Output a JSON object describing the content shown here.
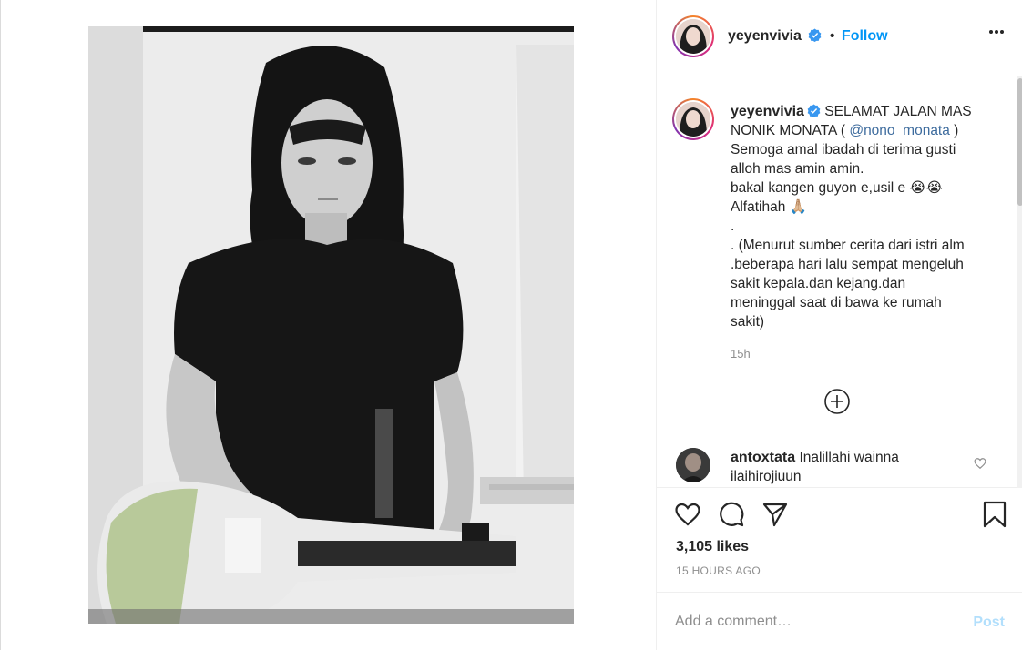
{
  "post": {
    "author": "yeyenvivia",
    "follow_label": "Follow",
    "separator": "•",
    "caption_lines": [
      "SELAMAT JALAN MAS",
      "NONIK MONATA ( ",
      "@nono_monata",
      " )",
      "Semoga amal ibadah di terima gusti",
      "alloh mas amin amin.",
      "bakal kangen guyon e,usil e 😭😭",
      "Alfatihah 🙏🏼",
      ".",
      ". (Menurut sumber cerita dari istri alm",
      ".beberapa hari lalu sempat mengeluh",
      "sakit kepala.dan kejang.dan",
      "meninggal saat di bawa ke rumah",
      "sakit)"
    ],
    "time_relative": "15h",
    "likes": "3,105 likes",
    "posted": "15 HOURS AGO"
  },
  "comment": {
    "author": "antoxtata",
    "text_line1": "Inalillahi wainna",
    "text_line2": "ilaihirojiuun"
  },
  "add_comment": {
    "placeholder": "Add a comment…",
    "post_label": "Post"
  },
  "colors": {
    "accent": "#0095f6",
    "verified": "#3897f0",
    "post_disabled": "#b2dffc",
    "muted": "#8e8e8e"
  },
  "icons": [
    "verified-badge-icon",
    "more-options-icon",
    "add-circle-icon",
    "heart-icon",
    "comment-icon",
    "share-icon",
    "bookmark-icon"
  ]
}
